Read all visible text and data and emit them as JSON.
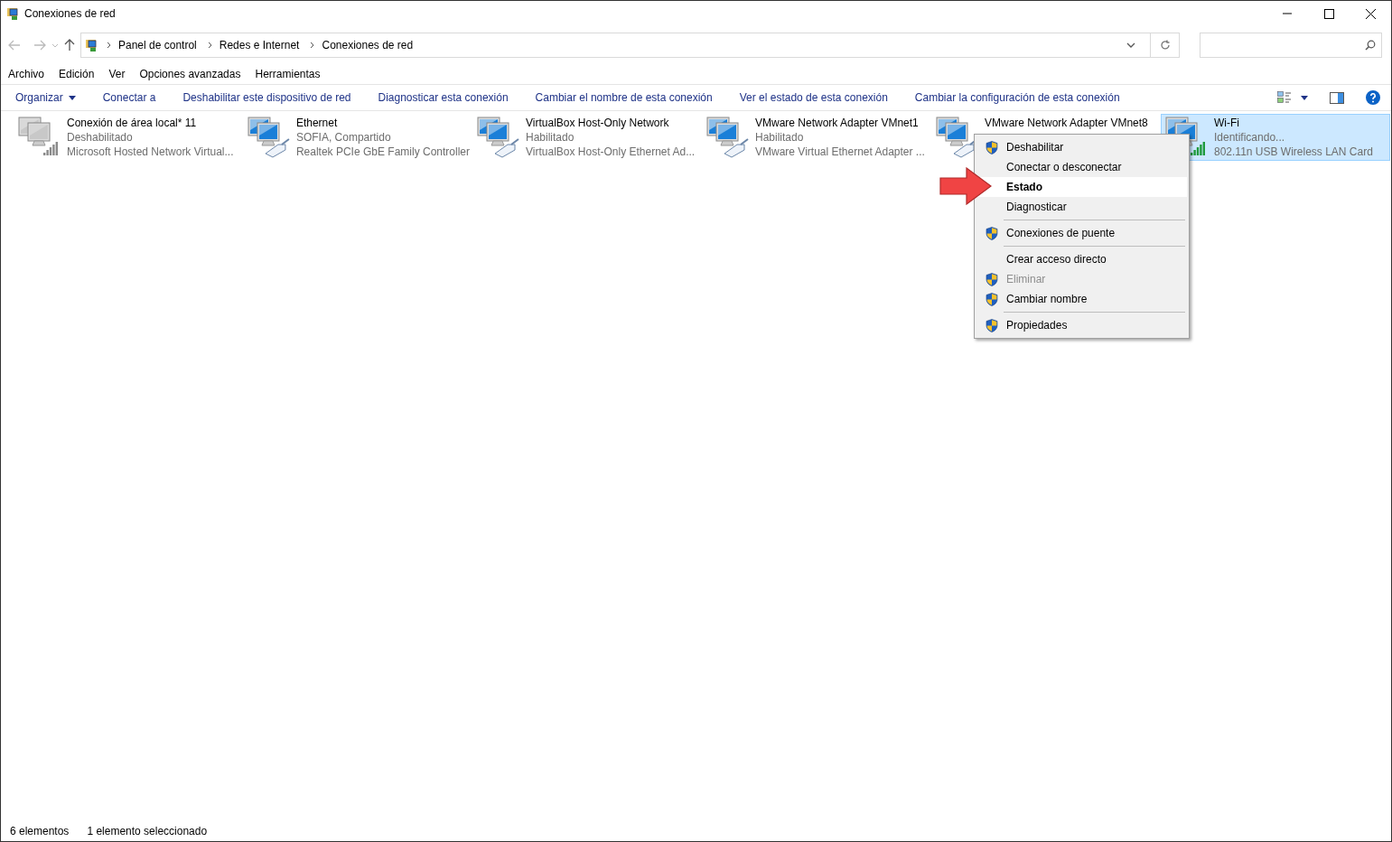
{
  "window": {
    "title": "Conexiones de red"
  },
  "address_bar": {
    "breadcrumbs": [
      "Panel de control",
      "Redes e Internet",
      "Conexiones de red"
    ]
  },
  "menu_bar": [
    "Archivo",
    "Edición",
    "Ver",
    "Opciones avanzadas",
    "Herramientas"
  ],
  "command_bar": [
    {
      "label": "Organizar",
      "dropdown": true
    },
    {
      "label": "Conectar a",
      "dropdown": false
    },
    {
      "label": "Deshabilitar este dispositivo de red",
      "dropdown": false
    },
    {
      "label": "Diagnosticar esta conexión",
      "dropdown": false
    },
    {
      "label": "Cambiar el nombre de esta conexión",
      "dropdown": false
    },
    {
      "label": "Ver el estado de esta conexión",
      "dropdown": false
    },
    {
      "label": "Cambiar la configuración de esta conexión",
      "dropdown": false
    }
  ],
  "connections": [
    {
      "name": "Conexión de área local* 11",
      "status": "Deshabilitado",
      "device": "Microsoft Hosted Network Virtual...",
      "kind": "wireless",
      "disabled": true,
      "selected": false
    },
    {
      "name": "Ethernet",
      "status": "SOFIA, Compartido",
      "device": "Realtek PCIe GbE Family Controller",
      "kind": "wired",
      "disabled": false,
      "selected": false
    },
    {
      "name": "VirtualBox Host-Only Network",
      "status": "Habilitado",
      "device": "VirtualBox Host-Only Ethernet Ad...",
      "kind": "wired",
      "disabled": false,
      "selected": false
    },
    {
      "name": "VMware Network Adapter VMnet1",
      "status": "Habilitado",
      "device": "VMware Virtual Ethernet Adapter ...",
      "kind": "wired",
      "disabled": false,
      "selected": false
    },
    {
      "name": "VMware Network Adapter VMnet8",
      "kind": "wired",
      "disabled": false,
      "selected": false
    },
    {
      "name": "Wi-Fi",
      "status": "Identificando...",
      "device": "802.11n USB Wireless LAN Card",
      "kind": "wireless",
      "disabled": false,
      "selected": true
    }
  ],
  "context_menu": [
    {
      "kind": "item",
      "label": "Deshabilitar",
      "shield": true,
      "disabled": false,
      "default": false,
      "selected": false
    },
    {
      "kind": "item",
      "label": "Conectar o desconectar",
      "shield": false,
      "disabled": false,
      "default": false,
      "selected": false
    },
    {
      "kind": "item",
      "label": "Estado",
      "shield": false,
      "disabled": false,
      "default": true,
      "selected": true
    },
    {
      "kind": "item",
      "label": "Diagnosticar",
      "shield": false,
      "disabled": false,
      "default": false,
      "selected": false
    },
    {
      "kind": "separator"
    },
    {
      "kind": "item",
      "label": "Conexiones de puente",
      "shield": true,
      "disabled": false,
      "default": false,
      "selected": false
    },
    {
      "kind": "separator"
    },
    {
      "kind": "item",
      "label": "Crear acceso directo",
      "shield": false,
      "disabled": false,
      "default": false,
      "selected": false
    },
    {
      "kind": "item",
      "label": "Eliminar",
      "shield": true,
      "disabled": true,
      "default": false,
      "selected": false
    },
    {
      "kind": "item",
      "label": "Cambiar nombre",
      "shield": true,
      "disabled": false,
      "default": false,
      "selected": false
    },
    {
      "kind": "separator"
    },
    {
      "kind": "item",
      "label": "Propiedades",
      "shield": true,
      "disabled": false,
      "default": false,
      "selected": false
    }
  ],
  "status_bar": [
    "6 elementos",
    "1 elemento seleccionado"
  ]
}
